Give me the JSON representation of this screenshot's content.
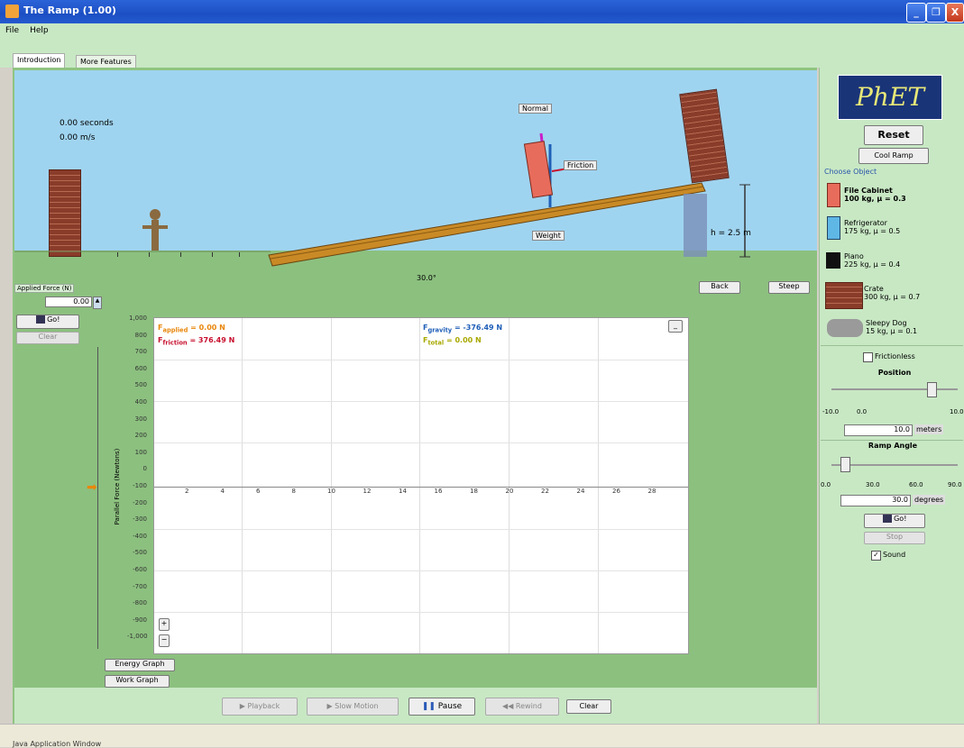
{
  "window": {
    "title": "The Ramp (1.00)",
    "buttons": [
      "_",
      "❐",
      "X"
    ]
  },
  "menu": [
    "File",
    "Help"
  ],
  "tabs": [
    "Introduction",
    "More Features"
  ],
  "sim": {
    "time_readout": "0.00 seconds",
    "speed_readout": "0.00 m/s",
    "labels": {
      "normal": "Normal",
      "friction": "Friction",
      "weight": "Weight",
      "height": "h = 2.5 m",
      "angle": "30.0°"
    },
    "buttons": {
      "back": "Back",
      "steep": "Steep"
    }
  },
  "applied_force": {
    "label": "Applied Force (N)",
    "value": "0.00",
    "go": "Go!",
    "clear": "Clear"
  },
  "graph": {
    "legend": {
      "applied": "F",
      "applied_sub": "applied",
      "applied_val": " = 0.00 N",
      "friction": "F",
      "friction_sub": "friction",
      "friction_val": " = 376.49 N",
      "gravity": "F",
      "gravity_sub": "gravity",
      "gravity_val": " = -376.49 N",
      "total": "F",
      "total_sub": "total",
      "total_val": " = 0.00 N"
    },
    "yaxis_label": "Parallel Force (Newtons)",
    "yticks": [
      "1,000",
      "800",
      "700",
      "600",
      "500",
      "400",
      "300",
      "200",
      "100",
      "0",
      "-100",
      "-200",
      "-300",
      "-400",
      "-500",
      "-600",
      "-700",
      "-800",
      "-900",
      "-1,000"
    ],
    "xticks": [
      "2",
      "4",
      "6",
      "8",
      "10",
      "12",
      "14",
      "16",
      "18",
      "20",
      "22",
      "24",
      "26",
      "28"
    ],
    "zoom": [
      "+",
      "−"
    ],
    "buttons": {
      "energy": "Energy Graph",
      "work": "Work Graph"
    },
    "minimize": "_"
  },
  "controls": {
    "playback": "Playback",
    "slow": "Slow Motion",
    "pause": "Pause",
    "rewind": "Rewind",
    "clear": "Clear"
  },
  "right": {
    "logo": "PhET",
    "reset": "Reset",
    "cool_ramp": "Cool Ramp",
    "choose_object": "Choose Object",
    "objects": [
      {
        "name": "File Cabinet",
        "desc": "100 kg, μ = 0.3"
      },
      {
        "name": "Refrigerator",
        "desc": "175 kg, μ = 0.5"
      },
      {
        "name": "Piano",
        "desc": "225 kg, μ = 0.4"
      },
      {
        "name": "Crate",
        "desc": "300 kg, μ = 0.7"
      },
      {
        "name": "Sleepy Dog",
        "desc": "15 kg, μ = 0.1"
      }
    ],
    "frictionless": "Frictionless",
    "position": {
      "title": "Position",
      "min": "-10.0",
      "mid": "0.0",
      "max": "10.0",
      "value": "10.0",
      "unit": "meters"
    },
    "ramp_angle": {
      "title": "Ramp Angle",
      "ticks": [
        "0.0",
        "30.0",
        "60.0",
        "90.0"
      ],
      "value": "30.0",
      "unit": "degrees"
    },
    "go": "Go!",
    "stop": "Stop",
    "sound": "Sound"
  },
  "status": "Java Application Window",
  "colors": {
    "sky": "#9fd4f0",
    "ground": "#8cc07f",
    "panel": "#c8e8c4",
    "friction": "#c8102e",
    "applied": "#e8870c",
    "gravity": "#1f5fb8",
    "total": "#a8a800"
  }
}
